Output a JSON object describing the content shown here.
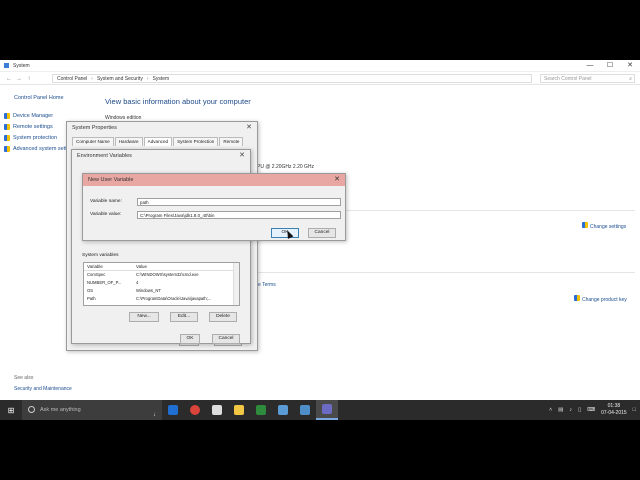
{
  "window": {
    "title": "System",
    "minimize": "—",
    "maximize": "☐",
    "close": "✕"
  },
  "address": {
    "back": "←",
    "forward": "→",
    "up": "↑",
    "crumbs": [
      "Control Panel",
      "System and Security",
      "System"
    ],
    "separator": "›",
    "search_placeholder": "Search Control Panel",
    "search_icon": "search-icon"
  },
  "leftnav": {
    "home": "Control Panel Home",
    "links": [
      "Device Manager",
      "Remote settings",
      "System protection",
      "Advanced system settings"
    ],
    "see_also": "See also",
    "security_maintenance": "Security and Maintenance"
  },
  "main": {
    "heading": "View basic information about your computer",
    "windows_edition": "Windows edition",
    "cpu_text": "PU @ 2.20GHz   2.20 GHz",
    "change_settings": "Change settings",
    "ms_terms": "e Terms",
    "change_product_key": "Change product key"
  },
  "system_properties": {
    "title": "System Properties",
    "close": "✕",
    "tabs": [
      "Computer Name",
      "Hardware",
      "Advanced",
      "System Protection",
      "Remote"
    ],
    "active_tab": "Advanced",
    "ok": "OK",
    "cancel": "Cancel"
  },
  "env_vars": {
    "title": "Environment Variables",
    "close": "✕",
    "system_variables_label": "System variables",
    "columns": [
      "Variable",
      "Value"
    ],
    "rows": [
      {
        "variable": "ComSpec",
        "value": "C:\\WINDOWS\\system32\\cmd.exe"
      },
      {
        "variable": "NUMBER_OF_P...",
        "value": "4"
      },
      {
        "variable": "OS",
        "value": "Windows_NT"
      },
      {
        "variable": "Path",
        "value": "C:\\ProgramData\\Oracle\\Java\\javapath;..."
      }
    ],
    "new": "New...",
    "edit": "Edit...",
    "delete": "Delete",
    "ok": "OK",
    "cancel": "Cancel"
  },
  "new_user_var": {
    "title": "New User Variable",
    "close": "✕",
    "name_label": "Variable name:",
    "name_value": "path",
    "value_label": "Variable value:",
    "value_value": "C:\\Program Files\\Java\\jdk1.8.0_40\\bin",
    "ok": "OK",
    "cancel": "Cancel"
  },
  "taskbar": {
    "start_icon": "windows-logo-icon",
    "search_placeholder": "Ask me anything",
    "time": "01:38",
    "date": "07-04-2015",
    "colors": {
      "edge": "#1e6fd1",
      "chrome": "#d9443b",
      "cmd": "#dddddd",
      "explorer": "#f2c744",
      "excel": "#2e8b3d",
      "store": "#5b9bd5",
      "controlpanel": "#4f8fc9",
      "system": "#6b6bc4"
    }
  }
}
